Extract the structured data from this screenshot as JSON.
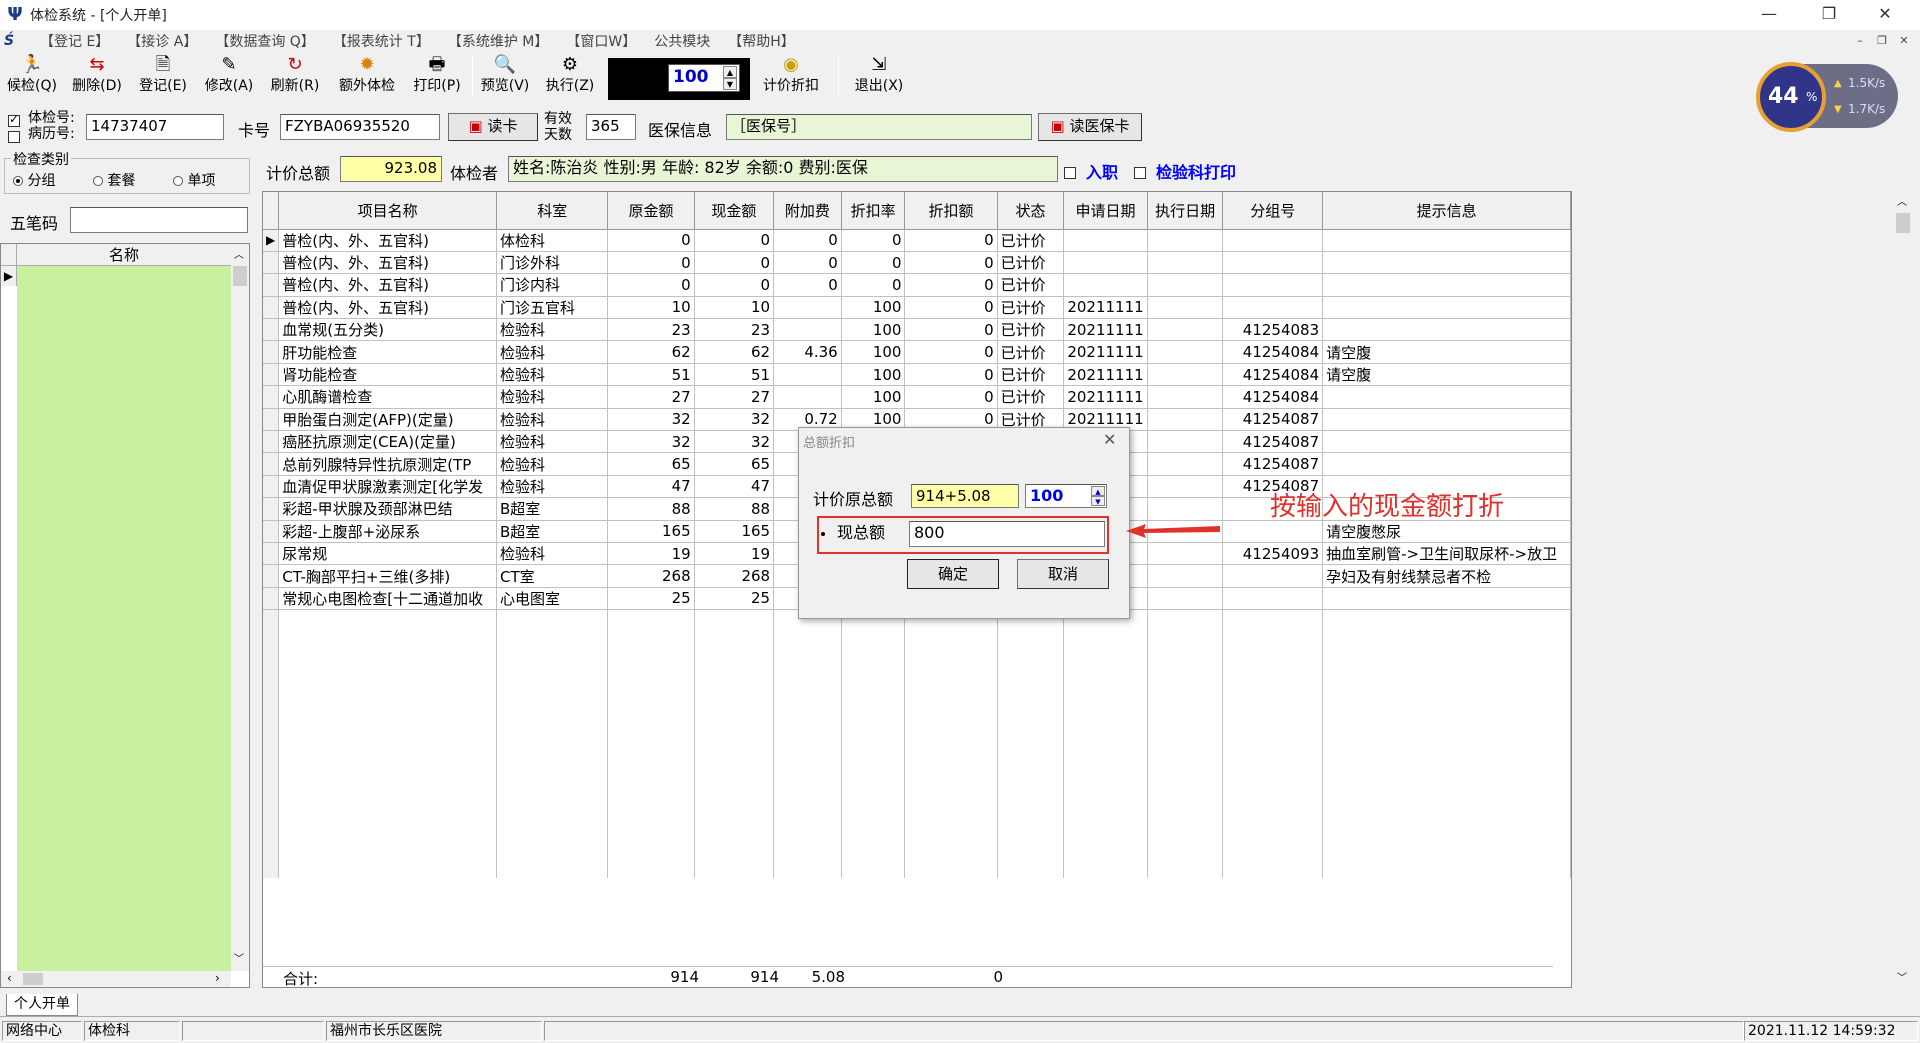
{
  "window": {
    "title": "体检系统 - [个人开单]",
    "minimize": "—",
    "restore": "❐",
    "close": "✕"
  },
  "menu": [
    "【登记 E】",
    "【接诊 A】",
    "【数据查询 Q】",
    "【报表统计 T】",
    "【系统维护 M】",
    "【窗口W】",
    "公共模块",
    "【帮助H】"
  ],
  "toolbar": {
    "items": [
      {
        "label": "候检(Q)",
        "icon": "person-run-icon"
      },
      {
        "label": "删除(D)",
        "icon": "delete-icon"
      },
      {
        "label": "登记(E)",
        "icon": "register-icon"
      },
      {
        "label": "修改(A)",
        "icon": "edit-icon"
      },
      {
        "label": "刷新(R)",
        "icon": "refresh-icon"
      },
      {
        "label": "额外体检",
        "icon": "extra-exam-icon"
      },
      {
        "label": "打印(P)",
        "icon": "printer-icon"
      },
      {
        "label": "预览(V)",
        "icon": "preview-icon"
      },
      {
        "label": "执行(Z)",
        "icon": "execute-gear-icon"
      },
      {
        "label": "计价折扣",
        "icon": "discount-icon"
      },
      {
        "label": "退出(X)",
        "icon": "exit-icon"
      }
    ],
    "spinner_value": "100"
  },
  "network_widget": {
    "percent": "44",
    "percent_sign": "%",
    "up": "1.5K/s",
    "down": "1.7K/s"
  },
  "form": {
    "exam_no_label": "体检号:",
    "record_no_label": "病历号:",
    "exam_no": "14737407",
    "card_label": "卡号",
    "card_no": "FZYBA06935520",
    "read_card": "读卡",
    "valid_days_label1": "有效",
    "valid_days_label2": "天数",
    "valid_days": "365",
    "insurance_label": "医保信息",
    "insurance_value": "［医保号］",
    "read_insurance_card": "读医保卡"
  },
  "category": {
    "title": "检查类别",
    "options": [
      "分组",
      "套餐",
      "单项"
    ],
    "selected": "分组"
  },
  "wubi_label": "五笔码",
  "left_list": {
    "header": "名称"
  },
  "summary": {
    "total_label": "计价总额",
    "total_value": "923.08",
    "examinee_label": "体检者",
    "examinee_info": "姓名:陈治炎 性别:男 年龄: 82岁 余额:0 费别:医保",
    "occupation_label": "入职",
    "lab_print_label": "检验科打印"
  },
  "grid": {
    "columns": [
      "项目名称",
      "科室",
      "原金额",
      "现金额",
      "附加费",
      "折扣率",
      "折扣额",
      "状态",
      "申请日期",
      "执行日期",
      "分组号",
      "提示信息"
    ],
    "rows": [
      [
        "普检(内、外、五官科)",
        "体检科",
        "0",
        "0",
        "0",
        "0",
        "0",
        "已计价",
        "",
        "",
        "",
        ""
      ],
      [
        "普检(内、外、五官科)",
        "门诊外科",
        "0",
        "0",
        "0",
        "0",
        "0",
        "已计价",
        "",
        "",
        "",
        ""
      ],
      [
        "普检(内、外、五官科)",
        "门诊内科",
        "0",
        "0",
        "0",
        "0",
        "0",
        "已计价",
        "",
        "",
        "",
        ""
      ],
      [
        "普检(内、外、五官科)",
        "门诊五官科",
        "10",
        "10",
        "",
        "100",
        "0",
        "已计价",
        "20211111",
        "",
        "",
        ""
      ],
      [
        "血常规(五分类)",
        "检验科",
        "23",
        "23",
        "",
        "100",
        "0",
        "已计价",
        "20211111",
        "",
        "41254083",
        ""
      ],
      [
        "肝功能检查",
        "检验科",
        "62",
        "62",
        "4.36",
        "100",
        "0",
        "已计价",
        "20211111",
        "",
        "41254084",
        "请空腹"
      ],
      [
        "肾功能检查",
        "检验科",
        "51",
        "51",
        "",
        "100",
        "0",
        "已计价",
        "20211111",
        "",
        "41254084",
        "请空腹"
      ],
      [
        "心肌酶谱检查",
        "检验科",
        "27",
        "27",
        "",
        "100",
        "0",
        "已计价",
        "20211111",
        "",
        "41254084",
        ""
      ],
      [
        "甲胎蛋白测定(AFP)(定量)",
        "检验科",
        "32",
        "32",
        "0.72",
        "100",
        "0",
        "已计价",
        "20211111",
        "",
        "41254087",
        ""
      ],
      [
        "癌胚抗原测定(CEA)(定量)",
        "检验科",
        "32",
        "32",
        "",
        "",
        "",
        "",
        "11",
        "",
        "41254087",
        ""
      ],
      [
        "总前列腺特异性抗原测定(TP",
        "检验科",
        "65",
        "65",
        "",
        "",
        "",
        "",
        "11",
        "",
        "41254087",
        ""
      ],
      [
        "血清促甲状腺激素测定[化学发",
        "检验科",
        "47",
        "47",
        "",
        "",
        "",
        "",
        "11",
        "",
        "41254087",
        ""
      ],
      [
        "彩超-甲状腺及颈部淋巴结",
        "B超室",
        "88",
        "88",
        "",
        "",
        "",
        "",
        "11",
        "",
        "",
        ""
      ],
      [
        "彩超-上腹部+泌尿系",
        "B超室",
        "165",
        "165",
        "",
        "",
        "",
        "",
        "11",
        "",
        "",
        "请空腹憋尿"
      ],
      [
        "尿常规",
        "检验科",
        "19",
        "19",
        "",
        "",
        "",
        "",
        "11",
        "",
        "41254093",
        "抽血室刷管->卫生间取尿杯->放卫"
      ],
      [
        "CT-胸部平扫+三维(多排)",
        "CT室",
        "268",
        "268",
        "",
        "",
        "",
        "",
        "11",
        "",
        "",
        "孕妇及有射线禁忌者不检"
      ],
      [
        "常规心电图检查[十二通道加收",
        "心电图室",
        "25",
        "25",
        "",
        "",
        "",
        "",
        "11",
        "",
        "",
        ""
      ]
    ],
    "totals": {
      "label": "合计:",
      "orig": "914",
      "cur": "914",
      "extra": "5.08",
      "discount": "0"
    }
  },
  "dialog": {
    "title": "总额折扣",
    "close": "✕",
    "orig_total_label": "计价原总额",
    "orig_total_value": "914+5.08",
    "rate_value": "100",
    "current_total_label": "现总额",
    "current_total_value": "800",
    "ok": "确定",
    "cancel": "取消"
  },
  "annotation": {
    "text": "按输入的现金额打折",
    "color": "#e0312b"
  },
  "tabs": [
    "个人开单"
  ],
  "status": {
    "cells": [
      "网络中心",
      "体检科",
      "",
      "福州市长乐区医院",
      "",
      "2021.11.12 14:59:32"
    ]
  },
  "colors": {
    "highlight_yellow": "#ffffa8",
    "list_green": "#c8f0a0",
    "insurance_green": "#e8f6d6",
    "link_blue": "#0000ff"
  }
}
